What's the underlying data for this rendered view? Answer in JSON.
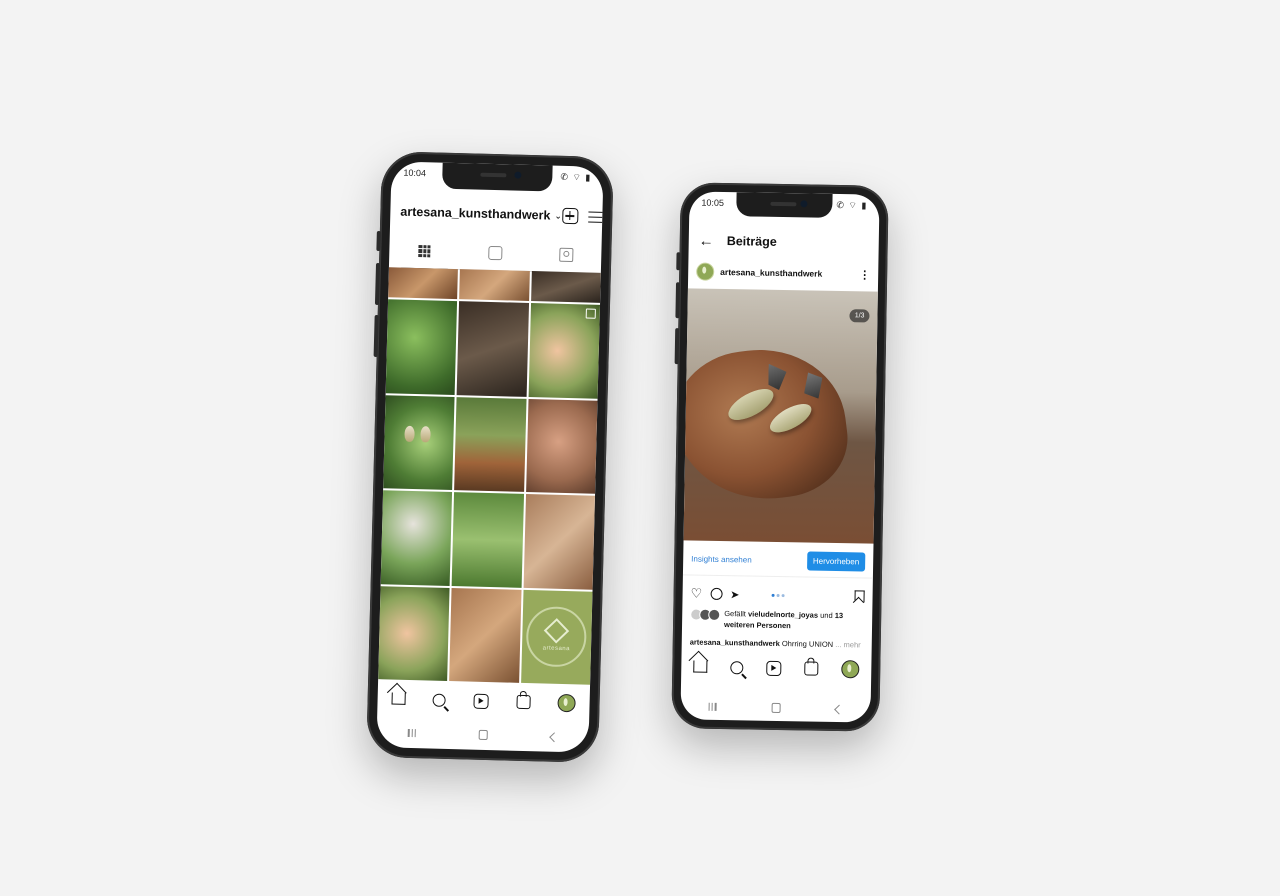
{
  "left_phone": {
    "status_time": "10:04",
    "status_icons": "✆ ⌔ ▮",
    "username": "artesana_kunsthandwerk",
    "tabs": [
      "grid-icon",
      "reels-icon",
      "tagged-icon"
    ],
    "grid_cells": 15,
    "logo_text": "artesana"
  },
  "right_phone": {
    "status_time": "10:05",
    "status_icons": "✆ ⌔ ▮",
    "title": "Beiträge",
    "author": "artesana_kunsthandwerk",
    "image_counter": "1/3",
    "insights_link": "Insights ansehen",
    "promote_button": "Hervorheben",
    "likes_prefix": "Gefällt",
    "likes_user": "vieludelnorte_joyas",
    "likes_and": "und",
    "likes_others": "13 weiteren Personen",
    "caption_user": "artesana_kunsthandwerk",
    "caption_text": "Ohrring UNION",
    "caption_more": "... mehr"
  },
  "bottom_nav": [
    "home-icon",
    "search-icon",
    "reels-icon",
    "shop-icon",
    "profile-avatar"
  ]
}
